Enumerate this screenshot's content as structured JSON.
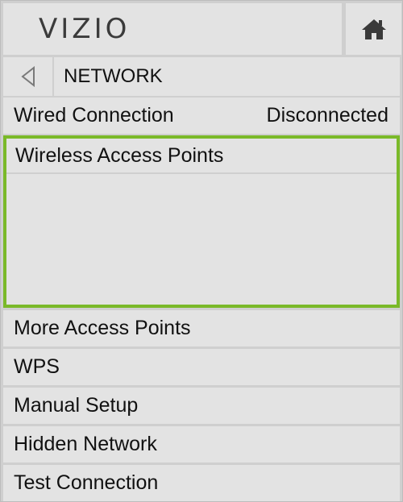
{
  "header": {
    "logo": "VIZIO",
    "home_icon": "home-icon"
  },
  "nav": {
    "back_icon": "back-arrow-icon",
    "title": "NETWORK"
  },
  "wired": {
    "label": "Wired Connection",
    "status": "Disconnected"
  },
  "wireless": {
    "label": "Wireless Access Points",
    "highlight_color": "#7ab929"
  },
  "menu_items": [
    {
      "label": "More Access Points"
    },
    {
      "label": "WPS"
    },
    {
      "label": "Manual Setup"
    },
    {
      "label": "Hidden Network"
    },
    {
      "label": "Test Connection"
    }
  ]
}
